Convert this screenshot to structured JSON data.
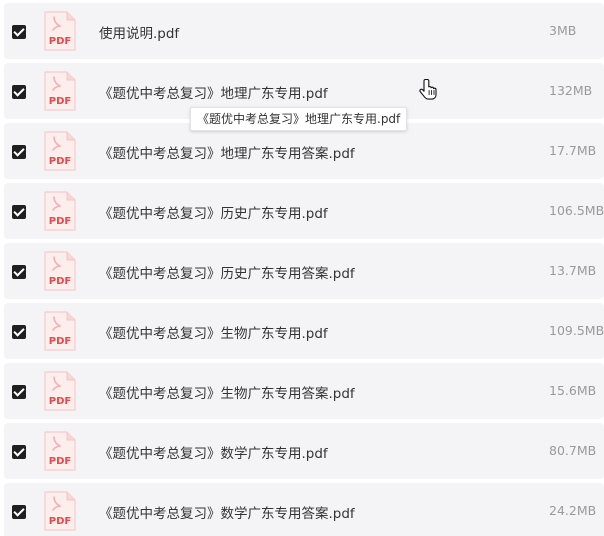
{
  "files": [
    {
      "name": "使用说明.pdf",
      "size": "3MB",
      "checked": true,
      "icon": "pdf-file-icon",
      "icon_label": "PDF"
    },
    {
      "name": "《题优中考总复习》地理广东专用.pdf",
      "size": "132MB",
      "checked": true,
      "icon": "pdf-file-icon",
      "icon_label": "PDF"
    },
    {
      "name": "《题优中考总复习》地理广东专用答案.pdf",
      "size": "17.7MB",
      "checked": true,
      "icon": "pdf-file-icon",
      "icon_label": "PDF"
    },
    {
      "name": "《题优中考总复习》历史广东专用.pdf",
      "size": "106.5MB",
      "checked": true,
      "icon": "pdf-file-icon",
      "icon_label": "PDF"
    },
    {
      "name": "《题优中考总复习》历史广东专用答案.pdf",
      "size": "13.7MB",
      "checked": true,
      "icon": "pdf-file-icon",
      "icon_label": "PDF"
    },
    {
      "name": "《题优中考总复习》生物广东专用.pdf",
      "size": "109.5MB",
      "checked": true,
      "icon": "pdf-file-icon",
      "icon_label": "PDF"
    },
    {
      "name": "《题优中考总复习》生物广东专用答案.pdf",
      "size": "15.6MB",
      "checked": true,
      "icon": "pdf-file-icon",
      "icon_label": "PDF"
    },
    {
      "name": "《题优中考总复习》数学广东专用.pdf",
      "size": "80.7MB",
      "checked": true,
      "icon": "pdf-file-icon",
      "icon_label": "PDF"
    },
    {
      "name": "《题优中考总复习》数学广东专用答案.pdf",
      "size": "24.2MB",
      "checked": true,
      "icon": "pdf-file-icon",
      "icon_label": "PDF"
    }
  ],
  "tooltip": {
    "text": "《题优中考总复习》地理广东专用.pdf"
  },
  "colors": {
    "row_bg": "#f4f4f6",
    "pdf_red": "#e5484d",
    "size_text": "#9a9a9a",
    "checkbox": "#1f1f1f"
  }
}
